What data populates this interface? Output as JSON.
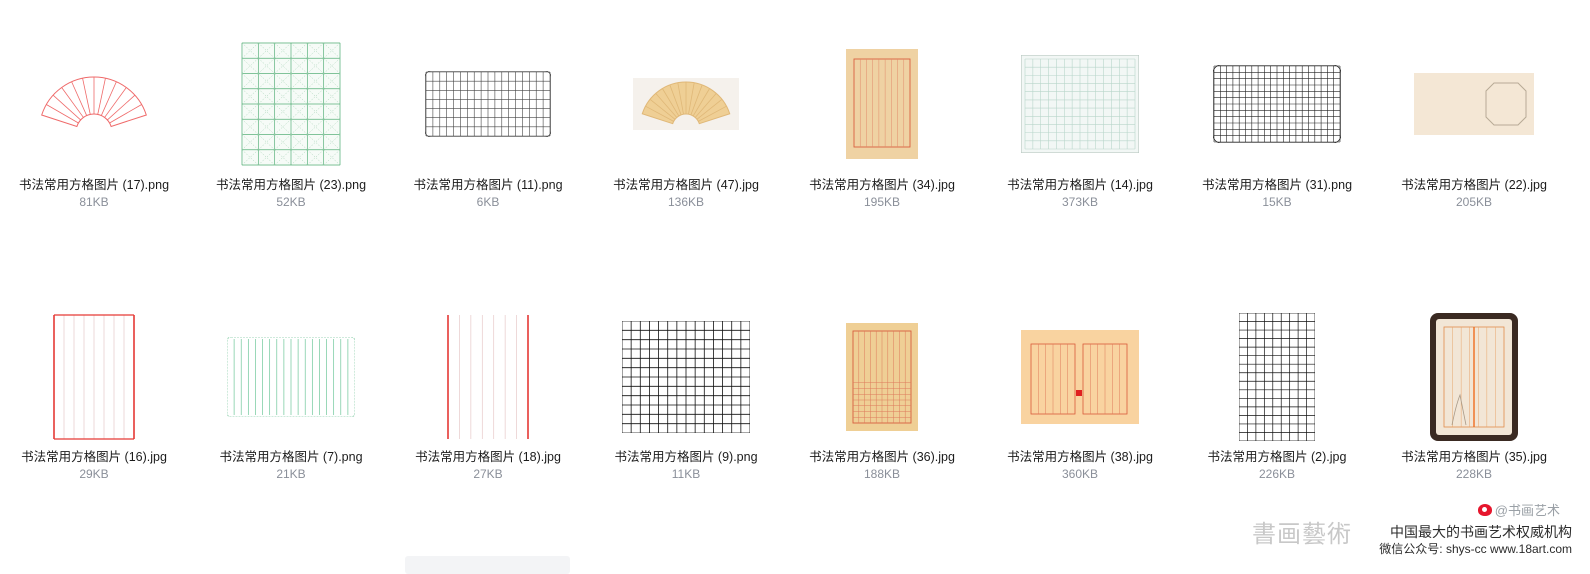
{
  "files": [
    {
      "name": "书法常用方格图片 (17).png",
      "size": "81KB",
      "thumb": "fan-red"
    },
    {
      "name": "书法常用方格图片 (23).png",
      "size": "52KB",
      "thumb": "mi-grid-green"
    },
    {
      "name": "书法常用方格图片 (11).png",
      "size": "6KB",
      "thumb": "grid-black-wide"
    },
    {
      "name": "书法常用方格图片 (47).jpg",
      "size": "136KB",
      "thumb": "fan-tan"
    },
    {
      "name": "书法常用方格图片 (34).jpg",
      "size": "195KB",
      "thumb": "columns-red-on-tan"
    },
    {
      "name": "书法常用方格图片 (14).jpg",
      "size": "373KB",
      "thumb": "grid-pale-teal"
    },
    {
      "name": "书法常用方格图片 (31).png",
      "size": "15KB",
      "thumb": "grid-black-dense"
    },
    {
      "name": "书法常用方格图片 (22).jpg",
      "size": "205KB",
      "thumb": "cream-octagon"
    },
    {
      "name": "书法常用方格图片 (16).jpg",
      "size": "29KB",
      "thumb": "columns-red-white"
    },
    {
      "name": "书法常用方格图片 (7).png",
      "size": "21KB",
      "thumb": "columns-green-white"
    },
    {
      "name": "书法常用方格图片 (18).jpg",
      "size": "27KB",
      "thumb": "columns-red-white-2"
    },
    {
      "name": "书法常用方格图片 (9).png",
      "size": "11KB",
      "thumb": "grid-black-large"
    },
    {
      "name": "书法常用方格图片 (36).jpg",
      "size": "188KB",
      "thumb": "tan-grid-red"
    },
    {
      "name": "书法常用方格图片 (38).jpg",
      "size": "360KB",
      "thumb": "book-spread"
    },
    {
      "name": "书法常用方格图片 (2).jpg",
      "size": "226KB",
      "thumb": "grid-black-tall"
    },
    {
      "name": "书法常用方格图片 (35).jpg",
      "size": "228KB",
      "thumb": "framed-columns"
    }
  ],
  "watermark": {
    "weibo": "@书画艺术",
    "seal": "書画藝術",
    "line1": "中国最大的书画艺术权威机构",
    "line2": "微信公众号: shys-cc www.18art.com"
  },
  "colors": {
    "name": "#1c1c1c",
    "size": "#8a8f99",
    "red": "#e53935",
    "green": "#4caf50",
    "tan": "#efcf95"
  }
}
